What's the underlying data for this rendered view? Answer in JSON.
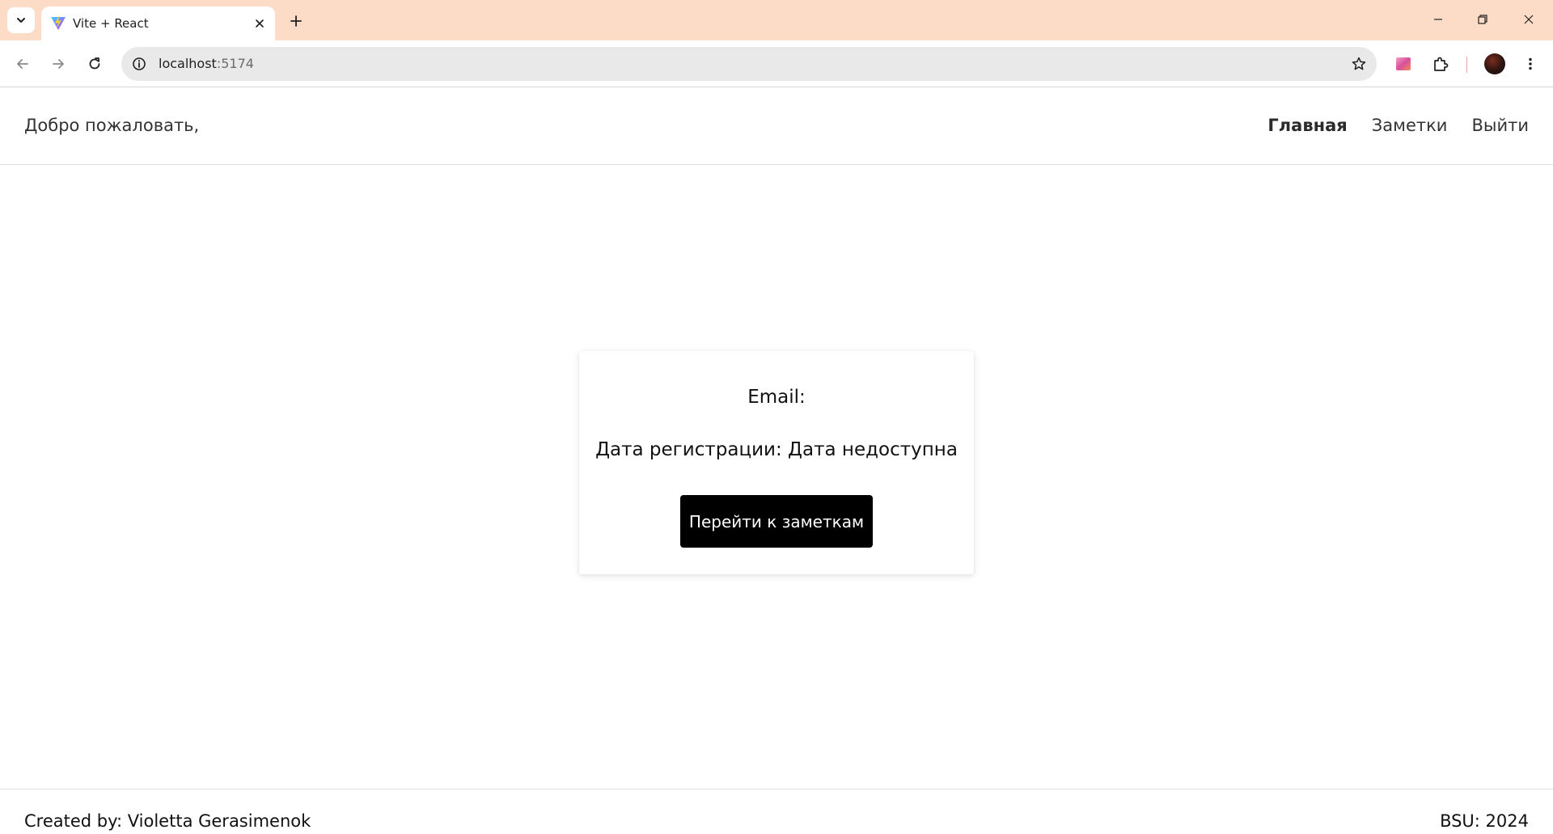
{
  "browser": {
    "tab": {
      "title": "Vite + React",
      "favicon": "vite-logo-icon"
    },
    "address": {
      "host": "localhost",
      "port": ":5174"
    },
    "icons": {
      "tab_search": "chevron-down-icon",
      "tab_close": "close-icon",
      "new_tab": "plus-icon",
      "back": "arrow-left-icon",
      "forward": "arrow-right-icon",
      "reload": "reload-icon",
      "site_info": "info-icon",
      "bookmark": "star-icon",
      "extension": "puzzle-icon",
      "menu": "kebab-menu-icon"
    },
    "colors": {
      "tabstrip": "#fcdcc7",
      "omnibox": "#e9e9e9"
    }
  },
  "header": {
    "welcome": "Добро пожаловать,",
    "nav": [
      {
        "label": "Главная",
        "active": true
      },
      {
        "label": "Заметки",
        "active": false
      },
      {
        "label": "Выйти",
        "active": false
      }
    ]
  },
  "card": {
    "email_line": "Email:",
    "date_line": "Дата регистрации: Дата недоступна",
    "button_label": "Перейти к заметкам"
  },
  "footer": {
    "left": "Created by: Violetta Gerasimenok",
    "right": "BSU: 2024"
  }
}
